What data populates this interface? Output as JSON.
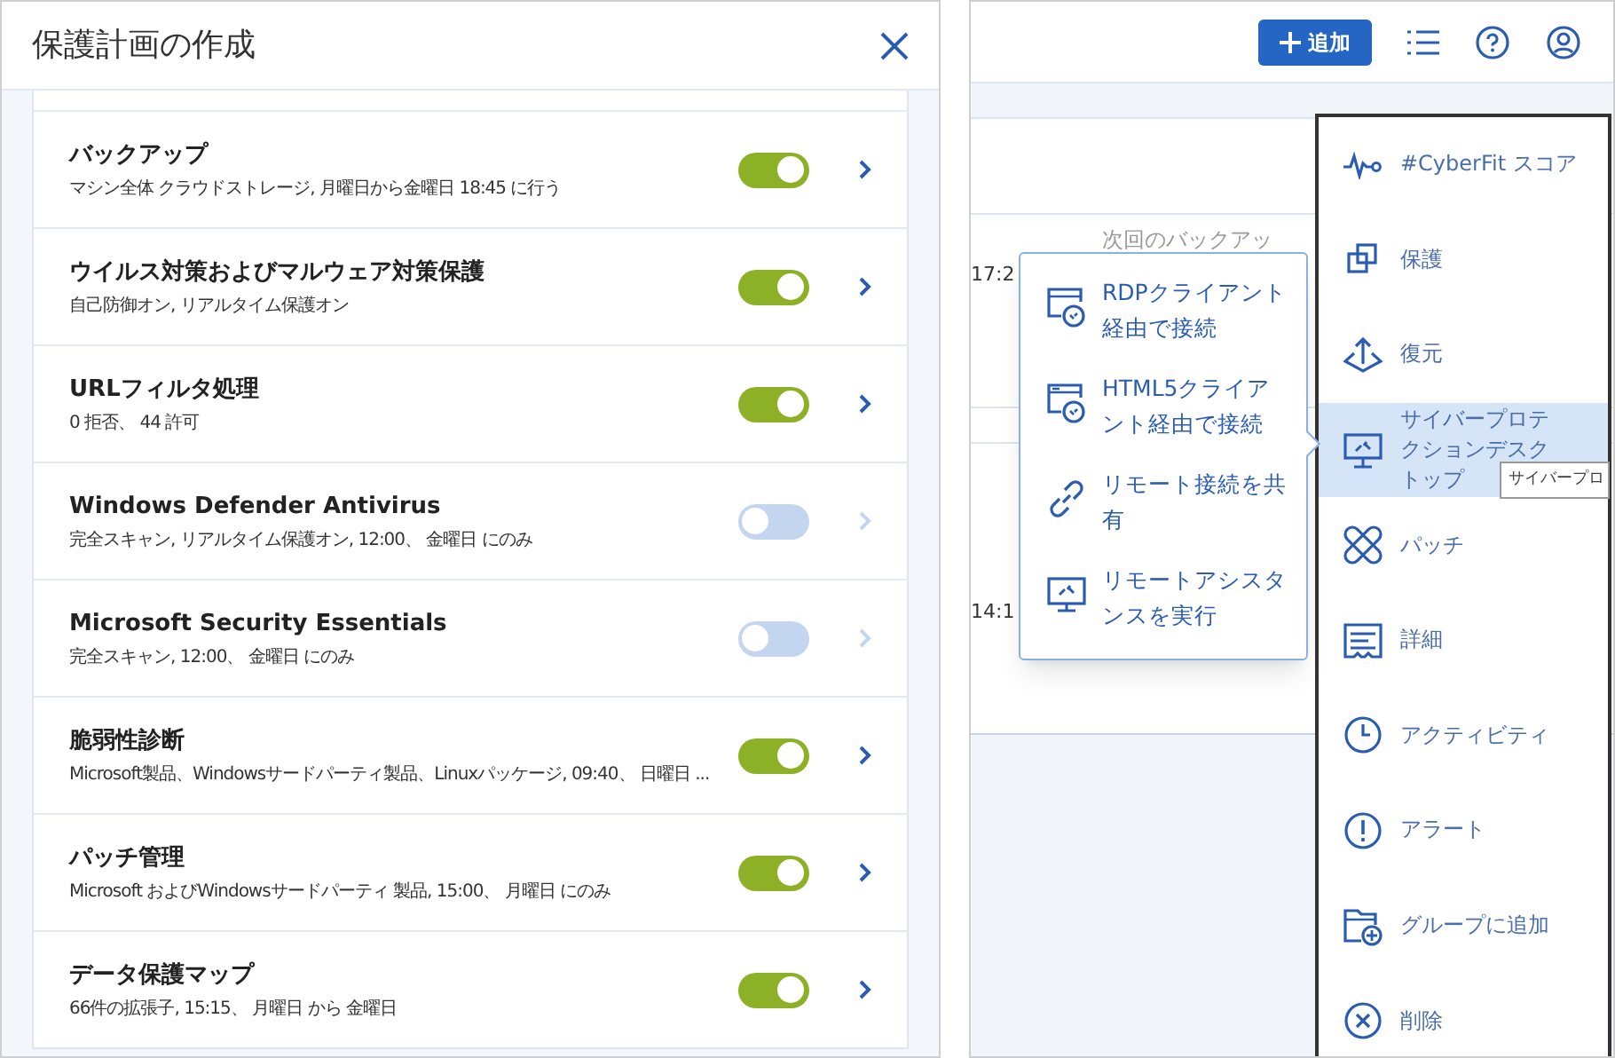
{
  "dialog": {
    "title": "保護計画の作成",
    "items": [
      {
        "title": "バックアップ",
        "subtitle": "マシン全体 クラウドストレージ, 月曜日から金曜日 18:45 に行う",
        "on": true
      },
      {
        "title": "ウイルス対策およびマルウェア対策保護",
        "subtitle": "自己防御オン, リアルタイム保護オン",
        "on": true
      },
      {
        "title": "URLフィルタ処理",
        "subtitle": "0 拒否、 44 許可",
        "on": true
      },
      {
        "title": "Windows Defender Antivirus",
        "subtitle": "完全スキャン, リアルタイム保護オン, 12:00、 金曜日 にのみ",
        "on": false
      },
      {
        "title": "Microsoft Security Essentials",
        "subtitle": "完全スキャン, 12:00、 金曜日 にのみ",
        "on": false
      },
      {
        "title": "脆弱性診断",
        "subtitle": "Microsoft製品、Windowsサードパーティ製品、Linuxパッケージ, 09:40、 日曜日 ...",
        "on": true
      },
      {
        "title": "パッチ管理",
        "subtitle": "Microsoft およびWindowsサードパーティ 製品, 15:00、 月曜日 にのみ",
        "on": true
      },
      {
        "title": "データ保護マップ",
        "subtitle": "66件の拡張子, 15:15、 月曜日 から 金曜日",
        "on": true
      }
    ]
  },
  "console": {
    "add_button": "追加",
    "column_header": "次回のバックアッ",
    "times": [
      "17:2",
      "14:1"
    ],
    "popover": {
      "items": [
        {
          "label": "RDPクライアント経由で接続"
        },
        {
          "label": "HTML5クライアント経由で接続"
        },
        {
          "label": "リモート接続を共有"
        },
        {
          "label": "リモートアシスタンスを実行"
        }
      ]
    },
    "context_menu": {
      "items": [
        {
          "label": "#CyberFit スコア",
          "selected": false
        },
        {
          "label": "保護",
          "selected": false
        },
        {
          "label": "復元",
          "selected": false
        },
        {
          "label": "サイバープロテクションデスクトップ",
          "selected": true
        },
        {
          "label": "パッチ",
          "selected": false
        },
        {
          "label": "詳細",
          "selected": false
        },
        {
          "label": "アクティビティ",
          "selected": false
        },
        {
          "label": "アラート",
          "selected": false
        },
        {
          "label": "グループに追加",
          "selected": false
        },
        {
          "label": "削除",
          "selected": false
        }
      ]
    },
    "tooltip": "サイバープロ"
  }
}
